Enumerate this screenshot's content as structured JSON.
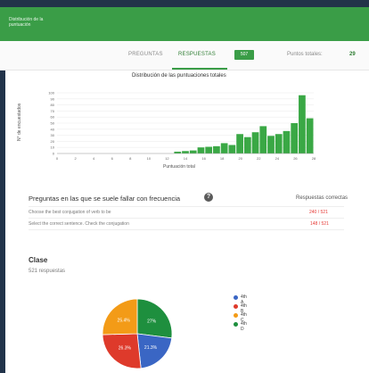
{
  "app": {
    "title": "Distribución de la puntuación"
  },
  "tabs": [
    {
      "label": "PREGUNTAS",
      "active": false
    },
    {
      "label": "RESPUESTAS",
      "active": true,
      "badge": "507"
    }
  ],
  "score": {
    "label": "Puntos totales:",
    "value": "29"
  },
  "chart_data": {
    "type": "bar",
    "title": "Distribución de las puntuaciones totales",
    "xlabel": "Puntuación total",
    "ylabel": "N° de encuestados",
    "x_ticks": [
      "0",
      "2",
      "4",
      "6",
      "8",
      "10",
      "12",
      "14",
      "16",
      "18",
      "20",
      "22",
      "24",
      "26",
      "28"
    ],
    "y_ticks": [
      "0",
      "10",
      "20",
      "30",
      "40",
      "50",
      "60",
      "70",
      "80",
      "90",
      "100"
    ],
    "ylim": [
      0,
      100
    ],
    "categories": [
      "0",
      "1",
      "2",
      "3",
      "4",
      "5",
      "6",
      "7",
      "8",
      "9",
      "10",
      "11",
      "12",
      "13",
      "14",
      "15",
      "16",
      "17",
      "18",
      "19",
      "20",
      "21",
      "22",
      "23",
      "24",
      "25",
      "26",
      "27",
      "28",
      "29"
    ],
    "values": [
      0,
      0,
      0,
      0,
      0,
      0,
      0,
      0,
      0,
      0,
      0,
      0,
      0,
      0,
      0,
      3,
      4,
      5,
      10,
      11,
      12,
      17,
      14,
      32,
      27,
      35,
      45,
      29,
      32,
      37,
      50,
      96,
      58
    ],
    "colors": {
      "bar": "#3aa845",
      "bar_dark": "#2e9a3a"
    }
  },
  "faq": {
    "title": "Preguntas en las que se suele fallar con frecuencia",
    "header": "Respuestas correctas",
    "rows": [
      {
        "question": "Choose the best conjugation of verb to be",
        "value": "240 / 521"
      },
      {
        "question": "Select the correct sentence. Check the conjugation",
        "value": "148 / 521"
      }
    ]
  },
  "class_section": {
    "title": "Clase",
    "subtitle": "521 respuestas",
    "pie": [
      {
        "label": "4th A",
        "value": 27,
        "text": "27%",
        "color": "#1e8f3e"
      },
      {
        "label": "4th B",
        "value": 21.3,
        "text": "21.3%",
        "color": "#3a66c4"
      },
      {
        "label": "4th C",
        "value": 26.3,
        "text": "26.3%",
        "color": "#de3a2b"
      },
      {
        "label": "4th D",
        "value": 25.4,
        "text": "25.4%",
        "color": "#f39b17"
      }
    ],
    "legend": [
      {
        "label": "4th A",
        "color": "#3a66c4"
      },
      {
        "label": "4th B",
        "color": "#de3a2b"
      },
      {
        "label": "4th C",
        "color": "#f39b17"
      },
      {
        "label": "4th D",
        "color": "#1e8f3e"
      }
    ]
  }
}
